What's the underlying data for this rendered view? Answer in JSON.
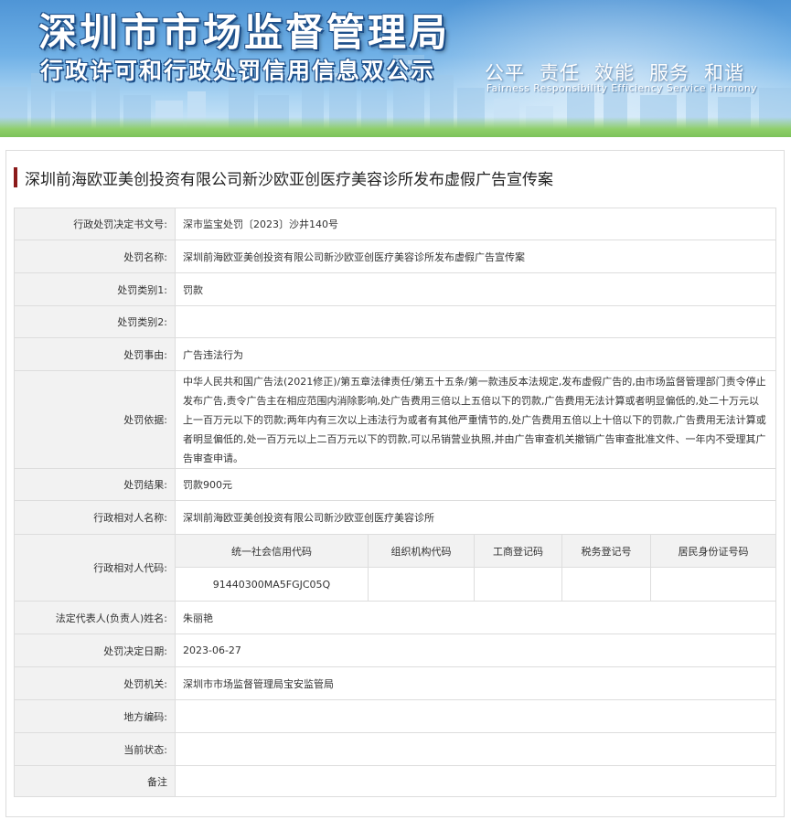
{
  "header": {
    "title_main": "深圳市市场监督管理局",
    "title_sub": "行政许可和行政处罚信用信息双公示",
    "motto_cn": [
      "公平",
      "责任",
      "效能",
      "服务",
      "和谐"
    ],
    "motto_en": "Fairness Responsibility Efficiency Service Harmony"
  },
  "case": {
    "title": "深圳前海欧亚美创投资有限公司新沙欧亚创医疗美容诊所发布虚假广告宣传案"
  },
  "fields": {
    "decision_no": {
      "label": "行政处罚决定书文号:",
      "value": "深市监宝处罚〔2023〕沙井140号"
    },
    "penalty_name": {
      "label": "处罚名称:",
      "value": "深圳前海欧亚美创投资有限公司新沙欧亚创医疗美容诊所发布虚假广告宣传案"
    },
    "category1": {
      "label": "处罚类别1:",
      "value": "罚款"
    },
    "category2": {
      "label": "处罚类别2:",
      "value": ""
    },
    "reason": {
      "label": "处罚事由:",
      "value": "广告违法行为"
    },
    "basis": {
      "label": "处罚依据:",
      "value": "中华人民共和国广告法(2021修正)/第五章法律责任/第五十五条/第一款违反本法规定,发布虚假广告的,由市场监督管理部门责令停止发布广告,责令广告主在相应范围内消除影响,处广告费用三倍以上五倍以下的罚款,广告费用无法计算或者明显偏低的,处二十万元以上一百万元以下的罚款;两年内有三次以上违法行为或者有其他严重情节的,处广告费用五倍以上十倍以下的罚款,广告费用无法计算或者明显偏低的,处一百万元以上二百万元以下的罚款,可以吊销营业执照,并由广告审查机关撤销广告审查批准文件、一年内不受理其广告审查申请。"
    },
    "result": {
      "label": "处罚结果:",
      "value": "罚款900元"
    },
    "party_name": {
      "label": "行政相对人名称:",
      "value": "深圳前海欧亚美创投资有限公司新沙欧亚创医疗美容诊所"
    },
    "party_code": {
      "label": "行政相对人代码:",
      "headers": [
        "统一社会信用代码",
        "组织机构代码",
        "工商登记码",
        "税务登记号",
        "居民身份证号码"
      ],
      "values": [
        "91440300MA5FGJC05Q",
        "",
        "",
        "",
        ""
      ]
    },
    "legal_rep": {
      "label": "法定代表人(负责人)姓名:",
      "value": "朱丽艳"
    },
    "decision_date": {
      "label": "处罚决定日期:",
      "value": "2023-06-27"
    },
    "authority": {
      "label": "处罚机关:",
      "value": "深圳市市场监督管理局宝安监管局"
    },
    "region_code": {
      "label": "地方编码:",
      "value": ""
    },
    "status": {
      "label": "当前状态:",
      "value": ""
    },
    "remark": {
      "label": "备注",
      "value": ""
    }
  },
  "colors": {
    "title_bar": "#8b1a1a",
    "label_bg": "#f2f2f2",
    "border": "#dddddd",
    "banner_blue": "#4f95d6"
  }
}
